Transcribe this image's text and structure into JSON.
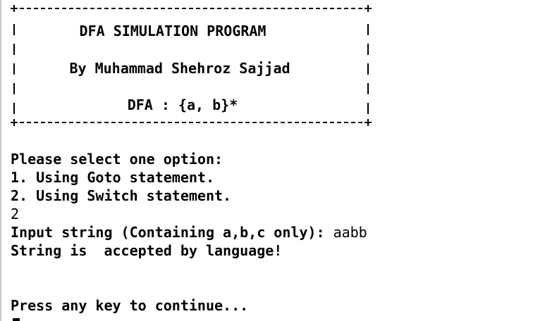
{
  "banner": {
    "title": "DFA SIMULATION PROGRAM",
    "author": "By Muhammad Shehroz Sajjad",
    "dfa": "DFA : {a, b}*"
  },
  "output": {
    "prompt": "Please select one option:",
    "option1": "1. Using Goto statement.",
    "option2": "2. Using Switch statement.",
    "choice": "2",
    "input_prompt": "Input string (Containing a,b,c only): ",
    "input_value": "aabb",
    "result": "String is  accepted by language!",
    "continue": "Press any key to continue..."
  }
}
